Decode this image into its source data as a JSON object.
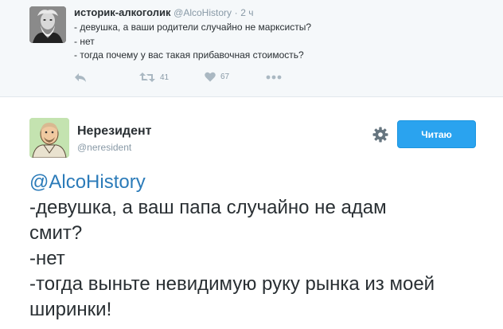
{
  "quoted_tweet": {
    "author_name": "историк-алкоголик",
    "author_handle": "@AlcoHistory",
    "separator": "·",
    "time": "2 ч",
    "lines": [
      "- девушка, а ваши родители случайно не марксисты?",
      "- нет",
      "- тогда почему у вас такая прибавочная стоимость?"
    ],
    "actions": {
      "reply_icon": "reply-icon",
      "retweet_icon": "retweet-icon",
      "retweet_count": "41",
      "like_icon": "heart-icon",
      "like_count": "67",
      "more_icon": "more-icon"
    }
  },
  "main_tweet": {
    "author_name": "Нерезидент",
    "author_handle": "@neresident",
    "follow_label": "Читаю",
    "mention": "@AlcoHistory",
    "lines": [
      "-девушка, а ваш папа случайно не адам",
      "смит?",
      "-нет",
      "-тогда выньте невидимую руку рынка из моей",
      "ширинки!"
    ]
  },
  "colors": {
    "accent": "#2aa3ef",
    "mention": "#2b7bb9",
    "muted": "#8899a6",
    "text": "#292f33"
  }
}
